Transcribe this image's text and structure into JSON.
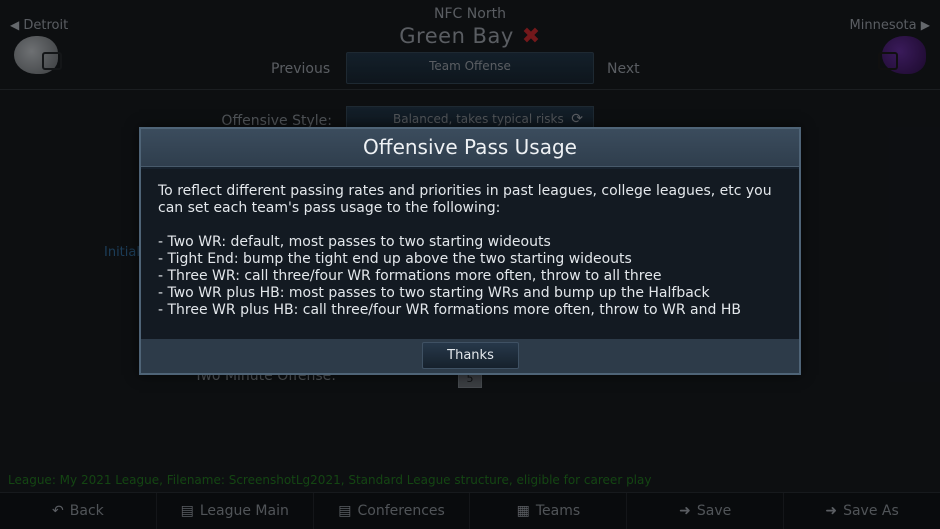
{
  "header": {
    "conference": "NFC North",
    "team": "Green Bay",
    "prev_team": "Detroit",
    "next_team": "Minnesota",
    "previous_label": "Previous",
    "next_label": "Next",
    "tab_label": "Team Offense"
  },
  "background_form": {
    "offensive_style_label": "Offensive Style:",
    "offensive_style_value": "Balanced, takes typical risks",
    "pass_usage_label_partial": "Initial",
    "two_minute_label": "Two Minute Offense:",
    "two_minute_value": "5"
  },
  "league_info": "League: My 2021 League,  Filename: ScreenshotLg2021,  Standard League structure, eligible for career play",
  "toolbar": {
    "back": "Back",
    "league_main": "League Main",
    "conferences": "Conferences",
    "teams": "Teams",
    "save": "Save",
    "save_as": "Save As"
  },
  "modal": {
    "title": "Offensive Pass Usage",
    "intro": "To reflect different passing rates and priorities in past leagues, college leagues, etc you can set each team's pass usage to the following:",
    "options": [
      "- Two WR: default, most passes to two starting wideouts",
      "- Tight End: bump the tight end up above the two starting wideouts",
      "- Three WR: call three/four WR formations more often, throw to all three",
      "- Two WR plus HB: most passes to two starting WRs and bump up the Halfback",
      "- Three WR plus HB: call three/four WR formations more often, throw to WR and HB"
    ],
    "button": "Thanks"
  }
}
